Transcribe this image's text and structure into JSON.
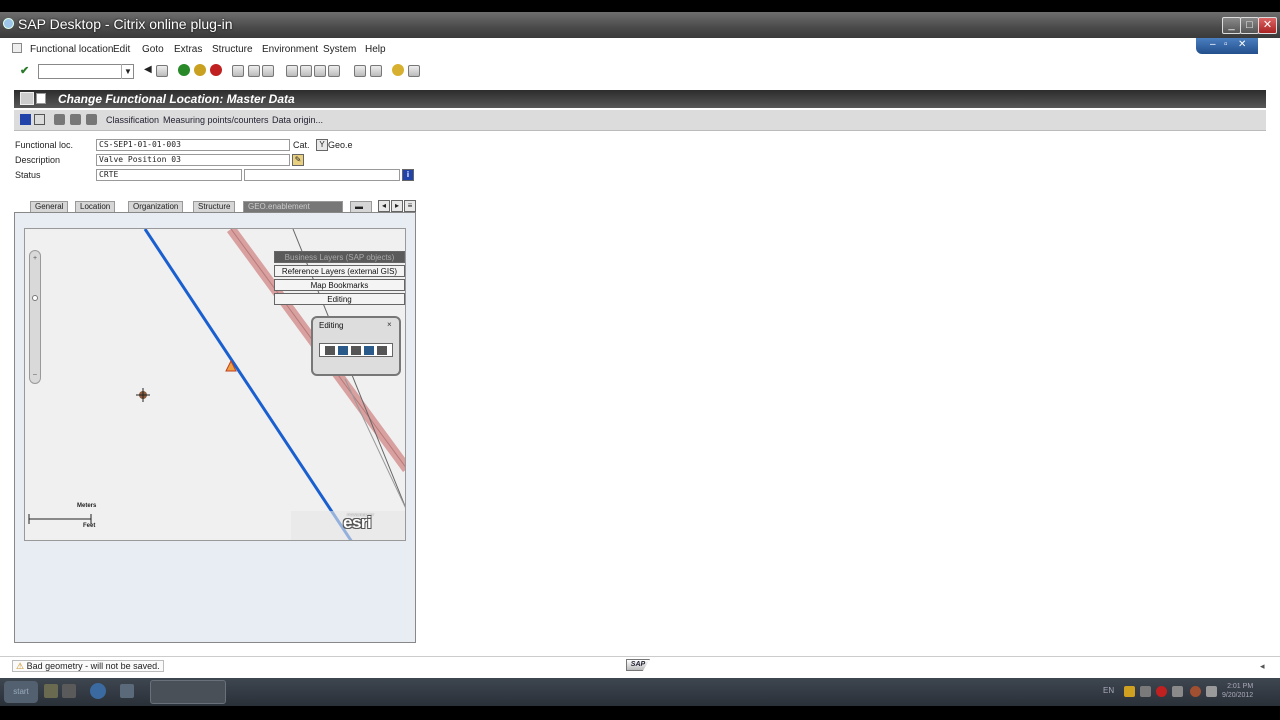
{
  "citrix": {
    "title": "SAP Desktop - Citrix online plug-in"
  },
  "menu": {
    "items": [
      "Functional location",
      "Edit",
      "Goto",
      "Extras",
      "Structure",
      "Environment",
      "System",
      "Help"
    ]
  },
  "page": {
    "title": "Change Functional Location: Master Data"
  },
  "app_toolbar": {
    "classification": "Classification",
    "measuring_points": "Measuring points/counters",
    "data_origin": "Data origin..."
  },
  "header": {
    "functional_loc_label": "Functional loc.",
    "functional_loc_value": "CS-SEP1-01-01-003",
    "cat_label": "Cat.",
    "cat_value": "Y",
    "cat_text": "Geo.e",
    "description_label": "Description",
    "description_value": "Valve Position 03",
    "status_label": "Status",
    "status_value": "CRTE"
  },
  "tabs": {
    "general": "General",
    "location": "Location",
    "organization": "Organization",
    "structure": "Structure",
    "geo": "GEO.enablement"
  },
  "map": {
    "layers": {
      "business": "Business Layers (SAP objects)",
      "reference": "Reference Layers (external GIS)",
      "bookmarks": "Map Bookmarks",
      "editing": "Editing"
    },
    "editing_dialog": {
      "title": "Editing",
      "close": "×"
    },
    "scale": {
      "meters": "Meters",
      "feet": "Feet"
    },
    "esri": {
      "powered": "POWERED BY",
      "logo": "esri"
    }
  },
  "status_bar": {
    "message": "Bad geometry - will not be saved."
  },
  "sap_logo": "SAP",
  "taskbar": {
    "start": "start",
    "lang": "EN",
    "time": "2:01 PM",
    "date": "9/20/2012"
  },
  "colors": {
    "pipeline_blue": "#1a5fd0",
    "pipeline_red": "#d9a0a0",
    "title_bar": "#3a3a3a",
    "tab_panel_bg": "#e8edf3"
  }
}
